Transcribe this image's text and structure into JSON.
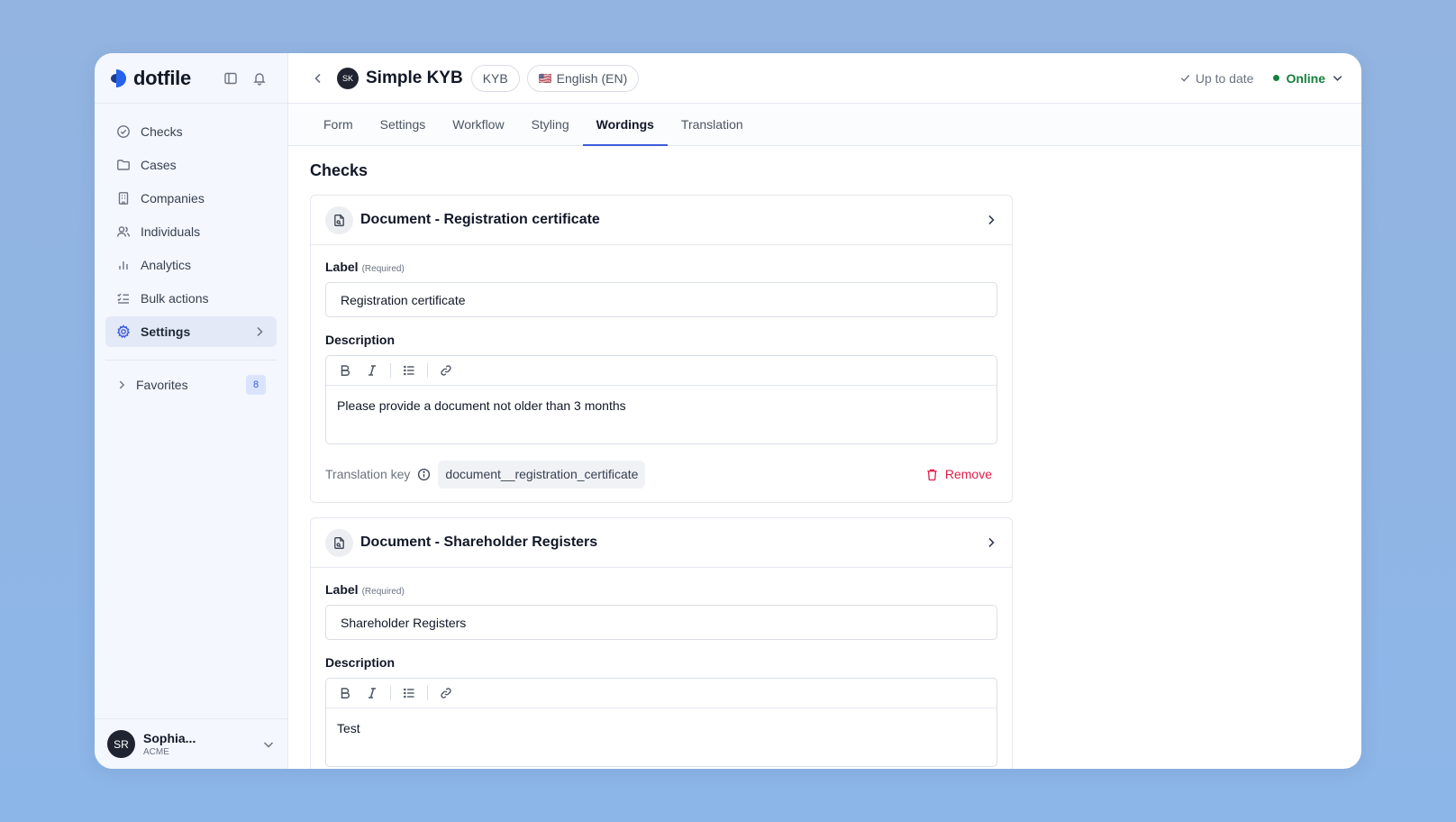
{
  "app": {
    "name": "dotfile"
  },
  "sidebar": {
    "items": [
      {
        "label": "Checks",
        "icon": "check-circle-icon"
      },
      {
        "label": "Cases",
        "icon": "folder-icon"
      },
      {
        "label": "Companies",
        "icon": "building-icon"
      },
      {
        "label": "Individuals",
        "icon": "users-icon"
      },
      {
        "label": "Analytics",
        "icon": "bar-chart-icon"
      },
      {
        "label": "Bulk actions",
        "icon": "list-checks-icon"
      },
      {
        "label": "Settings",
        "icon": "gear-icon",
        "active": true
      }
    ],
    "favorites": {
      "label": "Favorites",
      "count": "8"
    },
    "user": {
      "initials": "SR",
      "name": "Sophia...",
      "org": "ACME"
    }
  },
  "header": {
    "workflow_initials": "SK",
    "title": "Simple KYB",
    "type_badge": "KYB",
    "language": "English (EN)",
    "language_flag": "🇺🇸",
    "sync_status": "Up to date",
    "online_status": "Online"
  },
  "tabs": [
    {
      "label": "Form"
    },
    {
      "label": "Settings"
    },
    {
      "label": "Workflow"
    },
    {
      "label": "Styling"
    },
    {
      "label": "Wordings",
      "active": true
    },
    {
      "label": "Translation"
    }
  ],
  "main": {
    "section_title": "Checks",
    "field_labels": {
      "label": "Label",
      "required": "(Required)",
      "description": "Description",
      "translation_key": "Translation key",
      "remove": "Remove"
    },
    "checks": [
      {
        "title": "Document - Registration certificate",
        "label_value": "Registration certificate",
        "description": "Please provide a document not older than 3 months",
        "translation_key": "document__registration_certificate"
      },
      {
        "title": "Document - Shareholder Registers",
        "label_value": "Shareholder Registers",
        "description": "Test"
      }
    ]
  },
  "colors": {
    "accent": "#3b5bdb",
    "online": "#15803d",
    "danger": "#e11d48",
    "background": "#8db6e8"
  }
}
